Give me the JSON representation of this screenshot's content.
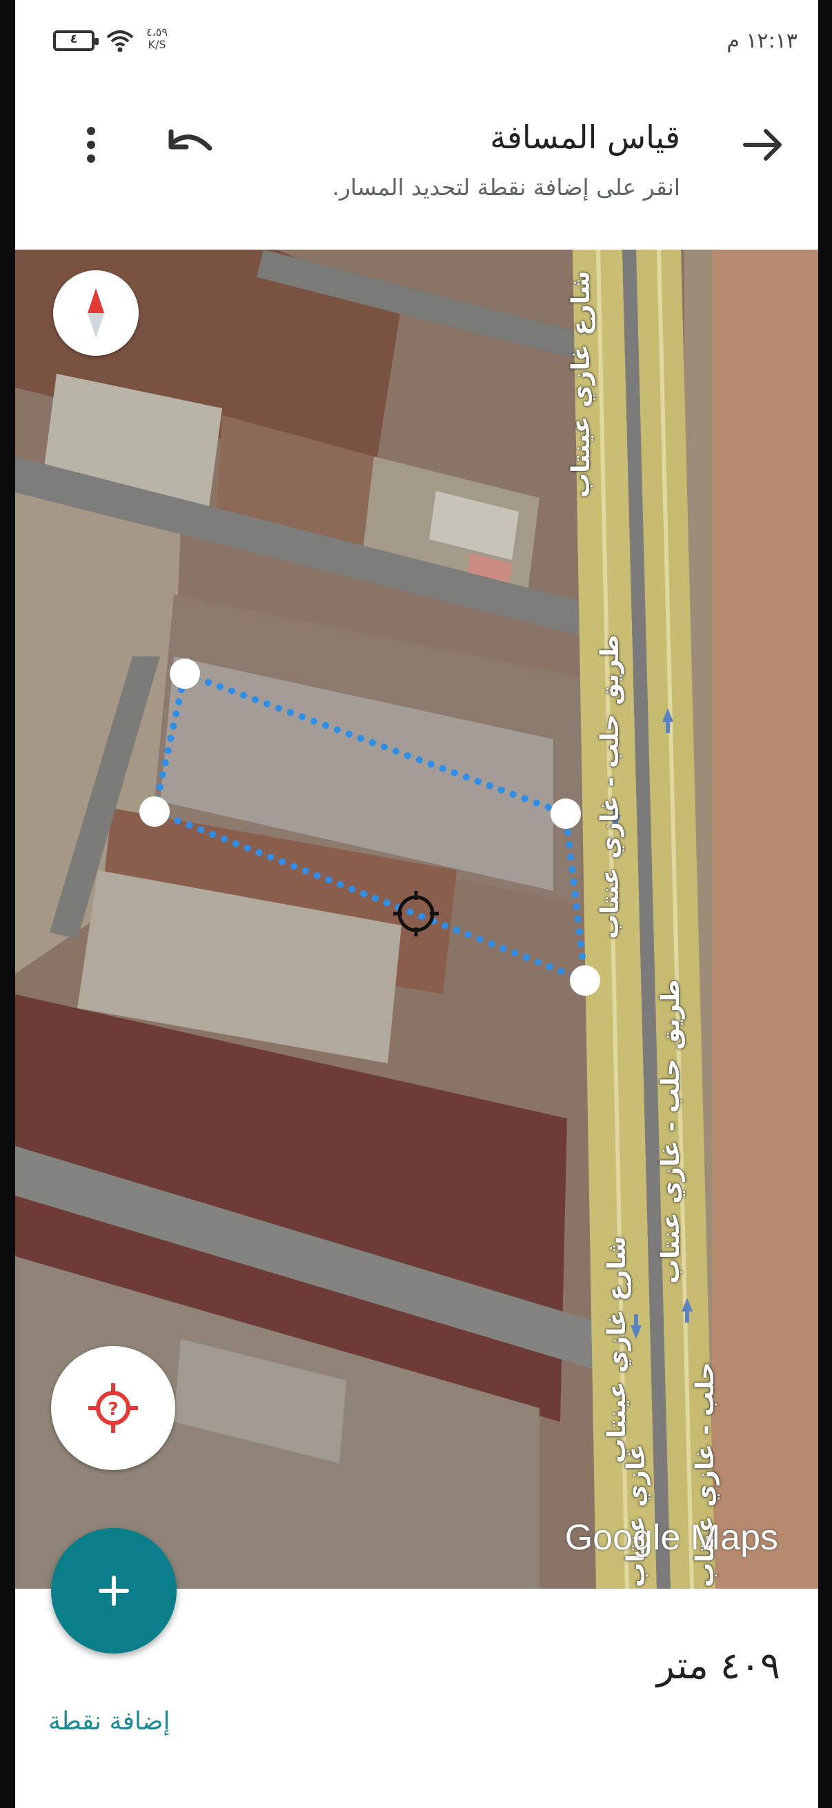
{
  "status_bar": {
    "time": "١٢:١٣ م",
    "battery": "٤",
    "net_speed_value": "٤،٥٩",
    "net_speed_unit": "K/S"
  },
  "app_bar": {
    "title": "قياس المسافة",
    "subtitle": "انقر على إضافة نقطة لتحديد المسار."
  },
  "map": {
    "road_labels": [
      "شارع غازي عينتاب",
      "طريق حلب - غازي عنتاب",
      "طريق حلب - غازي عنتاب",
      "شارع غازي عينتاب",
      "غازي عنتاب",
      "حلب - غازي عنتاب"
    ],
    "attribution": "Google Maps",
    "path_color": "#2f8ee8",
    "icons": [
      "compass-icon",
      "locate-icon"
    ]
  },
  "fab": {
    "icon": "plus-icon",
    "color": "#0a7f8a"
  },
  "bottom_sheet": {
    "distance": "٤٠٩ متر",
    "add_point": "إضافة نقطة"
  }
}
